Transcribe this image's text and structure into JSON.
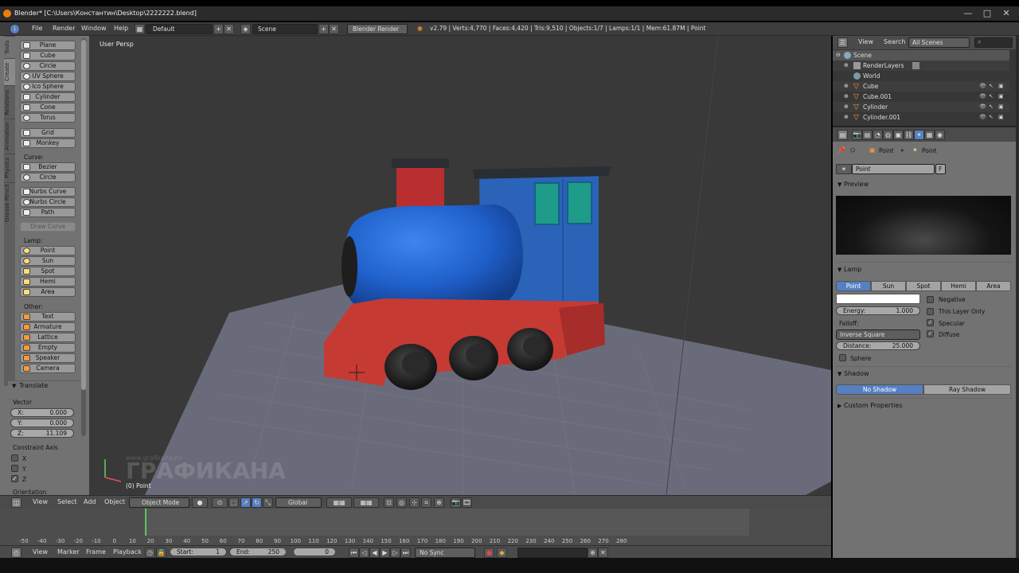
{
  "window": {
    "title": "Blender* [C:\\Users\\Константин\\Desktop\\2222222.blend]",
    "min": "—",
    "max": "□",
    "close": "✕"
  },
  "info": {
    "menus": [
      "File",
      "Render",
      "Window",
      "Help"
    ],
    "layout": "Default",
    "scene": "Scene",
    "engine": "Blender Render",
    "stats": "v2.79 | Verts:4,770 | Faces:4,420 | Tris:9,510 | Objects:1/7 | Lamps:1/1 | Mem:61.87M | Point"
  },
  "toolshelf": {
    "tabs": [
      "Tools",
      "Create",
      "Relations",
      "Animation",
      "Physics",
      "Grease Pencil"
    ],
    "mesh_items": [
      "Plane",
      "Cube",
      "Circle",
      "UV Sphere",
      "Ico Sphere",
      "Cylinder",
      "Cone",
      "Torus"
    ],
    "mesh2_items": [
      "Grid",
      "Monkey"
    ],
    "curve_label": "Curve:",
    "curve_items": [
      "Bezier",
      "Circle"
    ],
    "nurbs_items": [
      "Nurbs Curve",
      "Nurbs Circle",
      "Path"
    ],
    "draw_curve": "Draw Curve",
    "lamp_label": "Lamp:",
    "lamp_items": [
      "Point",
      "Sun",
      "Spot",
      "Hemi",
      "Area"
    ],
    "other_label": "Other:",
    "other_items": [
      "Text",
      "Armature",
      "Lattice",
      "Empty",
      "Speaker",
      "Camera"
    ]
  },
  "operator": {
    "title": "Translate",
    "vector_label": "Vector",
    "x_label": "X:",
    "x": "0.000",
    "y_label": "Y:",
    "y": "0.000",
    "z_label": "Z:",
    "z": "11.109",
    "constraint_label": "Constraint Axis",
    "axes": [
      "X",
      "Y",
      "Z"
    ],
    "orientation_label": "Orientation"
  },
  "viewport": {
    "label": "User Persp",
    "object_label": "(0) Point",
    "watermark": "ГРАФИКАНА",
    "watermark_small": "www.grafikana.ru",
    "colors": {
      "bg": "#393939",
      "boiler": "#1f5fc9",
      "cab": "#2a63b8",
      "base": "#c63a34",
      "window": "#1f9b8a",
      "wheel": "#1b1b1b",
      "floor": "#6a6b7a"
    }
  },
  "view_header": {
    "menus": [
      "View",
      "Select",
      "Add",
      "Object"
    ],
    "mode": "Object Mode",
    "orientation": "Global"
  },
  "timeline": {
    "ticks": [
      "-50",
      "-40",
      "-30",
      "-20",
      "-10",
      "0",
      "10",
      "20",
      "30",
      "40",
      "50",
      "60",
      "70",
      "80",
      "90",
      "100",
      "110",
      "120",
      "130",
      "140",
      "150",
      "160",
      "170",
      "180",
      "190",
      "200",
      "210",
      "220",
      "230",
      "240",
      "250",
      "260",
      "270",
      "280"
    ],
    "menus": [
      "View",
      "Marker",
      "Frame",
      "Playback"
    ],
    "start_label": "Start:",
    "start": "1",
    "end_label": "End:",
    "end": "250",
    "current": "0",
    "sync": "No Sync"
  },
  "outliner": {
    "menus": [
      "View",
      "Search"
    ],
    "scene_select": "All Scenes",
    "items": [
      {
        "label": "Scene"
      },
      {
        "label": "RenderLayers"
      },
      {
        "label": "World"
      },
      {
        "label": "Cube"
      },
      {
        "label": "Cube.001"
      },
      {
        "label": "Cylinder"
      },
      {
        "label": "Cylinder.001"
      }
    ]
  },
  "properties": {
    "breadcrumb": [
      "Point",
      "Point"
    ],
    "datablock": "Point",
    "fake_user": "F",
    "preview_title": "Preview",
    "lamp_title": "Lamp",
    "lamp_types": [
      "Point",
      "Sun",
      "Spot",
      "Hemi",
      "Area"
    ],
    "negative": "Negative",
    "energy_label": "Energy:",
    "energy": "1.000",
    "this_layer_only": "This Layer Only",
    "falloff_label": "Falloff:",
    "specular": "Specular",
    "falloff": "Inverse Square",
    "diffuse": "Diffuse",
    "distance_label": "Distance:",
    "distance": "25.000",
    "sphere": "Sphere",
    "shadow_title": "Shadow",
    "shadow_types": [
      "No Shadow",
      "Ray Shadow"
    ],
    "custom_props": "Custom Properties"
  }
}
